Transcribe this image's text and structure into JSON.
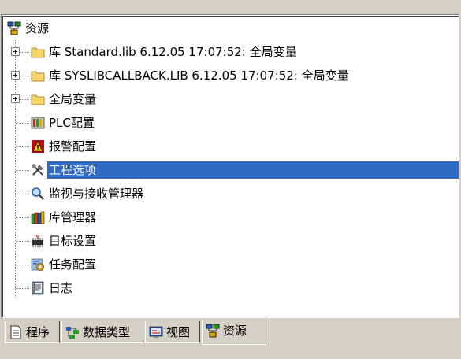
{
  "tree": {
    "root": {
      "label": "资源",
      "icon": "resources-icon"
    },
    "items": [
      {
        "label": "库 Standard.lib 6.12.05 17:07:52: 全局变量",
        "icon": "folder-icon",
        "expandable": true
      },
      {
        "label": "库 SYSLIBCALLBACK.LIB 6.12.05 17:07:52: 全局变量",
        "icon": "folder-icon",
        "expandable": true
      },
      {
        "label": "全局变量",
        "icon": "folder-icon",
        "expandable": true
      },
      {
        "label": "PLC配置",
        "icon": "plc-config-icon",
        "expandable": false
      },
      {
        "label": "报警配置",
        "icon": "alarm-config-icon",
        "expandable": false
      },
      {
        "label": "工程选项",
        "icon": "tools-icon",
        "expandable": false,
        "selected": true
      },
      {
        "label": "监视与接收管理器",
        "icon": "magnifier-icon",
        "expandable": false
      },
      {
        "label": "库管理器",
        "icon": "library-books-icon",
        "expandable": false
      },
      {
        "label": "目标设置",
        "icon": "target-icon",
        "expandable": false
      },
      {
        "label": "任务配置",
        "icon": "task-config-icon",
        "expandable": false
      },
      {
        "label": "日志",
        "icon": "log-icon",
        "expandable": false
      }
    ]
  },
  "tabs": [
    {
      "label": "程序",
      "icon": "document-icon"
    },
    {
      "label": "数据类型",
      "icon": "datatype-icon"
    },
    {
      "label": "视图",
      "icon": "visualization-icon"
    },
    {
      "label": "资源",
      "icon": "resources-icon",
      "active": true
    }
  ],
  "colors": {
    "selection": "#316ac5",
    "folder": "#f7d56b",
    "panel_bg": "#ffffff",
    "chrome": "#d4d0c8"
  }
}
